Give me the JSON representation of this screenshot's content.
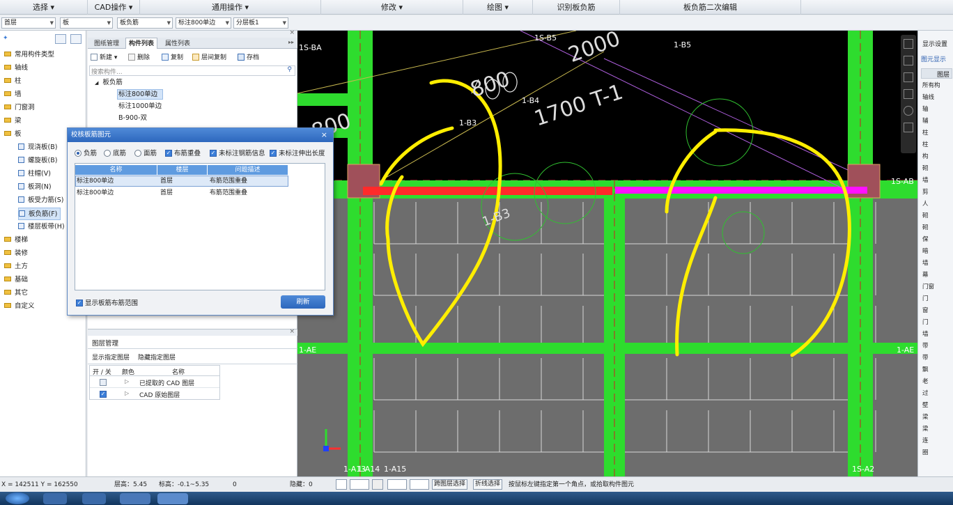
{
  "menubar": {
    "items": [
      "选择 ▾",
      "CAD操作 ▾",
      "通用操作 ▾",
      "修改 ▾",
      "绘图 ▾",
      "识别板负筋",
      "板负筋二次编辑"
    ]
  },
  "toolbar2": {
    "floor": "首层",
    "category": "板",
    "component_type": "板负筋",
    "component": "标注800单边",
    "layer_board": "分层板1"
  },
  "left_tree": {
    "items": [
      {
        "label": "常用构件类型",
        "level": 0
      },
      {
        "label": "轴线",
        "level": 0
      },
      {
        "label": "柱",
        "level": 0
      },
      {
        "label": "墙",
        "level": 0
      },
      {
        "label": "门窗洞",
        "level": 0
      },
      {
        "label": "梁",
        "level": 0
      },
      {
        "label": "板",
        "level": 0
      },
      {
        "label": "现浇板(B)",
        "level": 1
      },
      {
        "label": "螺旋板(B)",
        "level": 1
      },
      {
        "label": "柱帽(V)",
        "level": 1
      },
      {
        "label": "板洞(N)",
        "level": 1
      },
      {
        "label": "板受力筋(S)",
        "level": 1
      },
      {
        "label": "板负筋(F)",
        "level": 1
      },
      {
        "label": "楼层板带(H)",
        "level": 1
      },
      {
        "label": "楼梯",
        "level": 0
      },
      {
        "label": "装修",
        "level": 0
      },
      {
        "label": "土方",
        "level": 0
      },
      {
        "label": "基础",
        "level": 0
      },
      {
        "label": "其它",
        "level": 0
      },
      {
        "label": "自定义",
        "level": 0
      }
    ],
    "selected": "板负筋(F)"
  },
  "mid_panel": {
    "tabs": [
      "图纸管理",
      "构件列表",
      "属性列表"
    ],
    "active_tab": "构件列表",
    "toolbar": [
      "新建 ▾",
      "删除",
      "复制",
      "层间复制",
      "存档"
    ],
    "search_placeholder": "搜索构件...",
    "tree_root": "板负筋",
    "tree_items": [
      "标注800单边",
      "标注1000单边",
      "B-900-双"
    ]
  },
  "layer_manager": {
    "title": "图层管理",
    "actions": [
      "显示指定图层",
      "隐藏指定图层"
    ],
    "headers": [
      "开 / 关",
      "颜色",
      "名称"
    ],
    "rows": [
      {
        "name": "已提取的 CAD 图层",
        "checked": false
      },
      {
        "name": "CAD 原始图层",
        "checked": true
      }
    ]
  },
  "dialog": {
    "title": "校核板筋图元",
    "close": "×",
    "options": {
      "radio": [
        "负筋",
        "底筋",
        "面筋"
      ],
      "checks": [
        "布筋重叠",
        "未标注钢筋信息",
        "未标注伸出长度"
      ]
    },
    "headers": [
      "名称",
      "楼层",
      "问题描述"
    ],
    "rows": [
      [
        "标注800单边",
        "首层",
        "布筋范围重叠"
      ],
      [
        "标注800单边",
        "首层",
        "布筋范围重叠"
      ]
    ],
    "show_range_label": "显示板筋布筋范围",
    "refresh_label": "刷新"
  },
  "canvas": {
    "labels": [
      "1S-BA",
      "1S-B5",
      "1-B5",
      "1-B4",
      "1-B3",
      "1S-AB",
      "1-AE",
      "1-AE",
      "1-A13",
      "1-A14",
      "1-A15",
      "1S-A2"
    ],
    "big_texts": [
      "800",
      "2000",
      "1700",
      "1-B3"
    ],
    "slab_texts": [
      "1700 T-1"
    ],
    "colors": {
      "column": "#2edc2e",
      "red_bar": "#ff2a2a",
      "magenta_bar": "#ff10ff",
      "mark": "#ffee00",
      "grid": "#dcdcdc",
      "bg": "#000000",
      "slab": "#6d6d6d"
    }
  },
  "right_panel": {
    "tabs": [
      "显示设置",
      "图元显示"
    ],
    "header": "图层",
    "items": [
      "所有构",
      "轴线",
      "轴",
      "辅",
      "柱",
      "柱",
      "构",
      "砌",
      "墙",
      "剪",
      "人",
      "砌",
      "砌",
      "保",
      "暗",
      "墙",
      "幕",
      "门窗",
      "门",
      "窗",
      "门",
      "墙",
      "带",
      "带",
      "飘",
      "老",
      "过",
      "壁",
      "梁",
      "梁",
      "连",
      "圈"
    ]
  },
  "statusbar": {
    "coords": "X = 142511 Y = 162550",
    "layer_height": "层高：5.45",
    "elevation": "标高：-0.1~5.35",
    "zero": "0",
    "hidden": "隐藏：0",
    "btn1": "跨图层选择",
    "btn2": "折线选择",
    "hint": "按鼠标左键指定第一个角点，或拾取构件图元"
  }
}
